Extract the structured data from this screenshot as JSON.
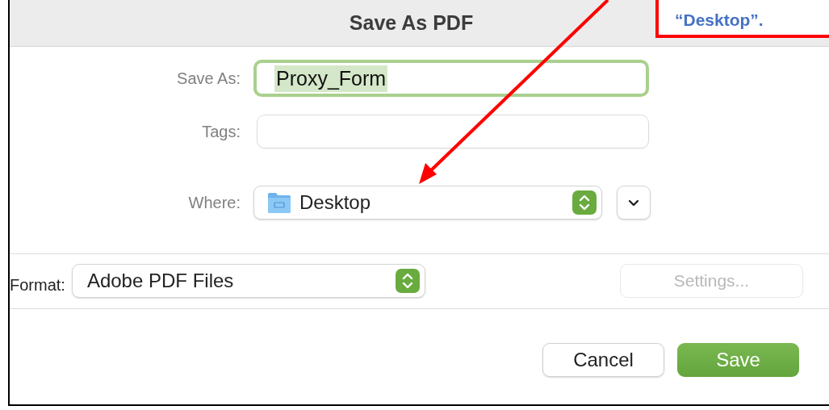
{
  "window": {
    "title": "Save As PDF"
  },
  "callout": {
    "text": "“Desktop”."
  },
  "save_as": {
    "label": "Save As:",
    "value": "Proxy_Form",
    "focused": true
  },
  "tags": {
    "label": "Tags:"
  },
  "where": {
    "label": "Where:",
    "value": "Desktop"
  },
  "format": {
    "label": "Format:",
    "value": "Adobe PDF Files"
  },
  "settings": {
    "label": "Settings...",
    "disabled": true
  },
  "buttons": [
    {
      "label": "Cancel",
      "default": false
    },
    {
      "label": "Save",
      "default": true
    }
  ]
}
